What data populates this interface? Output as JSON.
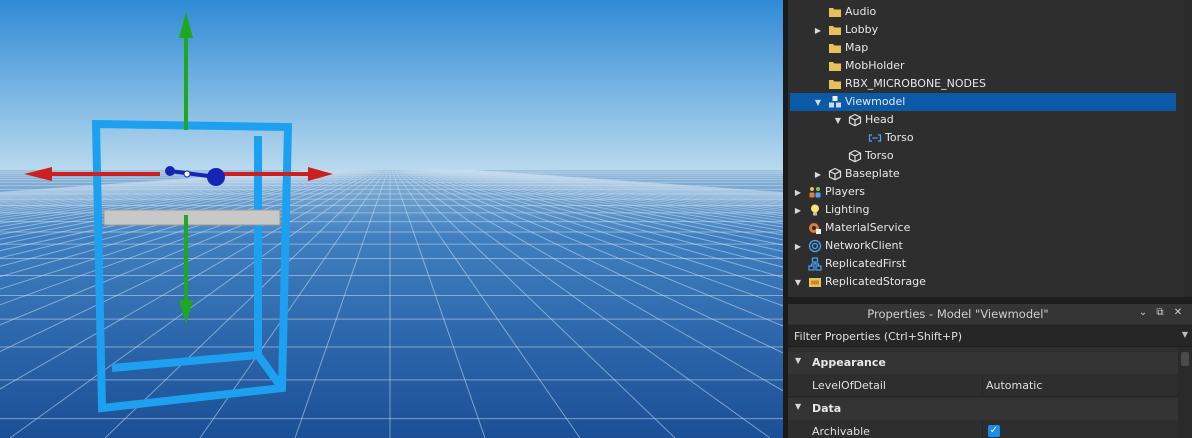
{
  "explorer": {
    "items": [
      {
        "label": "Audio",
        "icon": "folder-icon",
        "expanded": null,
        "level": 2
      },
      {
        "label": "Lobby",
        "icon": "folder-icon",
        "expanded": false,
        "level": 2
      },
      {
        "label": "Map",
        "icon": "folder-icon",
        "expanded": null,
        "level": 2
      },
      {
        "label": "MobHolder",
        "icon": "folder-icon",
        "expanded": null,
        "level": 2
      },
      {
        "label": "RBX_MICROBONE_NODES",
        "icon": "folder-icon",
        "expanded": null,
        "level": 2
      },
      {
        "label": "Viewmodel",
        "icon": "model-icon",
        "expanded": true,
        "level": 2,
        "selected": true
      },
      {
        "label": "Head",
        "icon": "part-icon",
        "expanded": true,
        "level": 3
      },
      {
        "label": "Torso",
        "icon": "motor6d-icon",
        "expanded": null,
        "level": 4
      },
      {
        "label": "Torso",
        "icon": "part-icon",
        "expanded": null,
        "level": 3
      },
      {
        "label": "Baseplate",
        "icon": "part-icon",
        "expanded": false,
        "level": 2
      },
      {
        "label": "Players",
        "icon": "players-icon",
        "expanded": false,
        "level": 1
      },
      {
        "label": "Lighting",
        "icon": "lighting-icon",
        "expanded": false,
        "level": 1
      },
      {
        "label": "MaterialService",
        "icon": "material-service-icon",
        "expanded": null,
        "level": 1
      },
      {
        "label": "NetworkClient",
        "icon": "network-client-icon",
        "expanded": false,
        "level": 1
      },
      {
        "label": "ReplicatedFirst",
        "icon": "replicated-first-icon",
        "expanded": null,
        "level": 1
      },
      {
        "label": "ReplicatedStorage",
        "icon": "replicated-storage-icon",
        "expanded": true,
        "level": 1
      }
    ]
  },
  "properties": {
    "title": "Properties - Model \"Viewmodel\"",
    "filter_placeholder": "Filter Properties (Ctrl+Shift+P)",
    "sections": [
      {
        "name": "Appearance",
        "rows": [
          {
            "name": "LevelOfDetail",
            "value": "Automatic"
          }
        ]
      },
      {
        "name": "Data",
        "rows": [
          {
            "name": "Archivable",
            "value": true
          }
        ]
      }
    ]
  },
  "colors": {
    "selection": "#0b5aa8",
    "folder": "#e8c15a",
    "axis_x": "#cc1f1f",
    "axis_y": "#1fa81f",
    "selection_box": "#1ea0f0",
    "checkbox": "#1d8ee8"
  }
}
